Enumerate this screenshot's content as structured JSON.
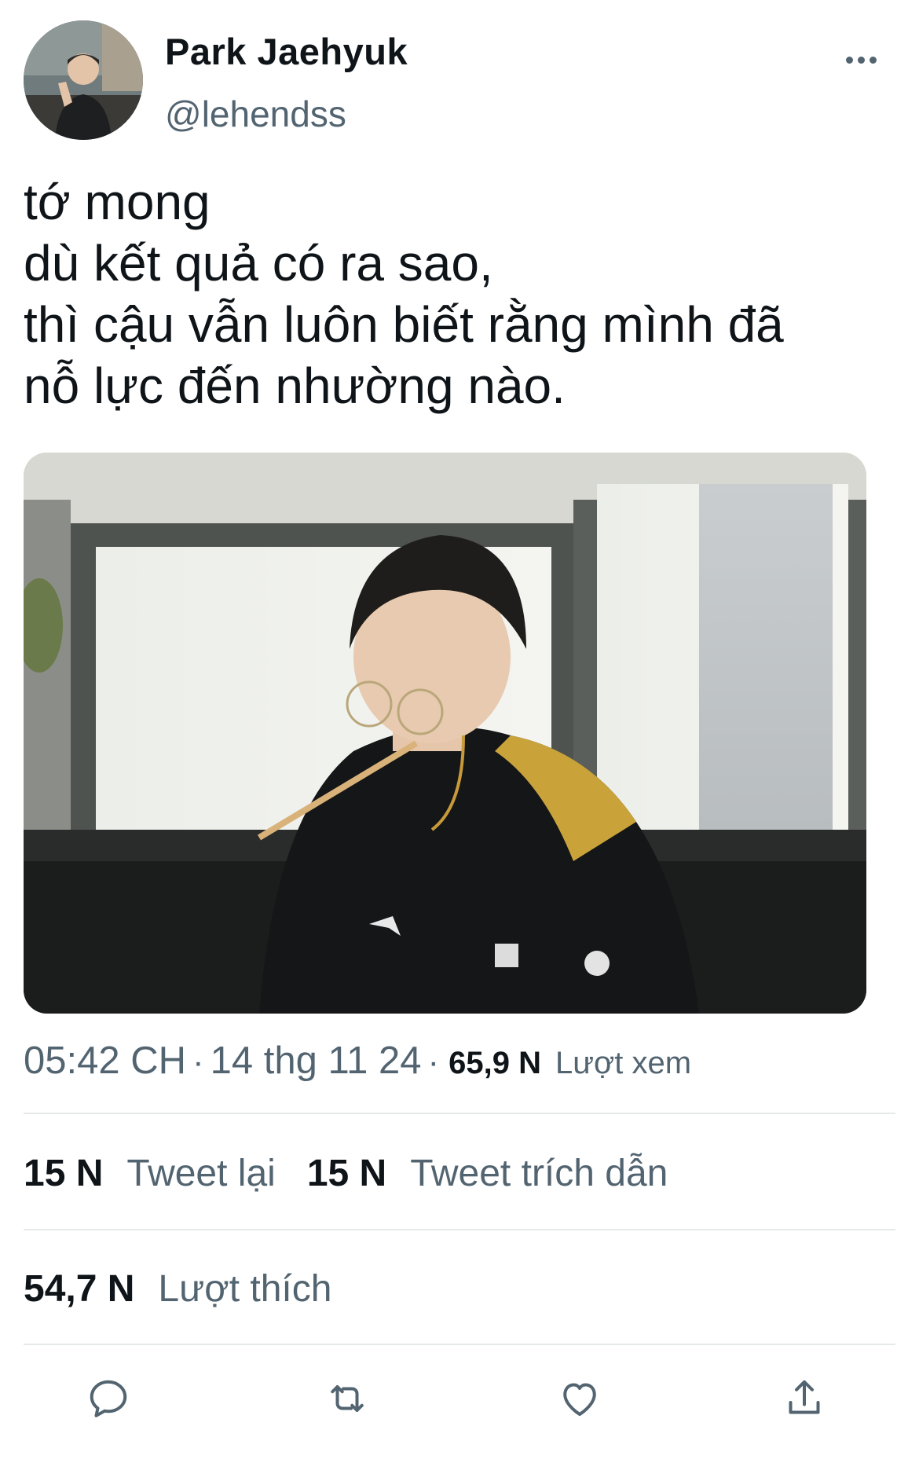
{
  "author": {
    "display_name": "Park Jaehyuk",
    "handle": "@lehendss"
  },
  "icons": {
    "more": "more-dots-icon",
    "reply": "reply-icon",
    "retweet": "retweet-icon",
    "like": "heart-icon",
    "share": "share-icon"
  },
  "tweet": {
    "lines": [
      "tớ mong",
      "dù kết quả có ra sao,",
      "thì cậu vẫn luôn biết rằng mình đã",
      "nỗ lực đến nhường nào."
    ]
  },
  "meta": {
    "time": "05:42 CH",
    "separator": "·",
    "date": "14 thg 11 24",
    "separator2": "·",
    "views_count": "65,9 N",
    "views_label": "Lượt xem"
  },
  "stats": {
    "retweets_count": "15 N",
    "retweets_label": "Tweet lại",
    "quotes_count": "15 N",
    "quotes_label": "Tweet trích dẫn",
    "likes_count": "54,7 N",
    "likes_label": "Lượt thích"
  },
  "colors": {
    "text_primary": "#0f1419",
    "text_secondary": "#536471",
    "divider": "#e6e9ea"
  }
}
